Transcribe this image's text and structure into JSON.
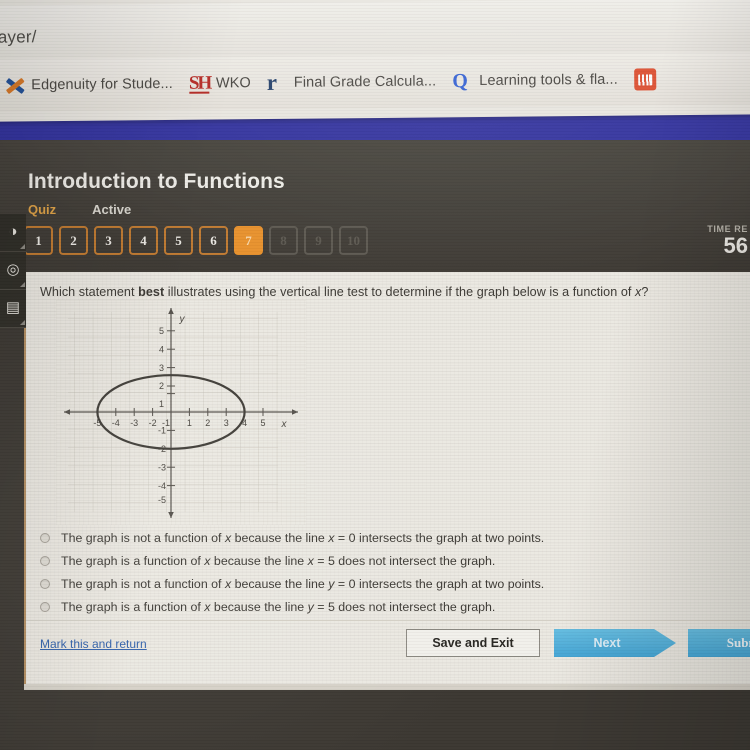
{
  "browser": {
    "url_fragment": "ayer/",
    "bookmarks": [
      {
        "label": "Edgenuity for Stude...",
        "icon": "edgenuity-x-icon"
      },
      {
        "label": "WKO",
        "icon": "sh-icon"
      },
      {
        "label": "Final Grade Calcula...",
        "icon": "rogue-r-icon"
      },
      {
        "label": "Learning tools & fla...",
        "icon": "quizlet-q-icon"
      },
      {
        "label": "",
        "icon": "soundcloud-icon"
      }
    ]
  },
  "header": {
    "title": "Introduction to Functions",
    "type_label": "Quiz",
    "state_label": "Active",
    "timer_label": "TIME RE",
    "timer_value": "56",
    "question_tabs": [
      {
        "number": "1",
        "state": "done"
      },
      {
        "number": "2",
        "state": "done"
      },
      {
        "number": "3",
        "state": "done"
      },
      {
        "number": "4",
        "state": "done"
      },
      {
        "number": "5",
        "state": "done"
      },
      {
        "number": "6",
        "state": "done"
      },
      {
        "number": "7",
        "state": "active"
      },
      {
        "number": "8",
        "state": "locked"
      },
      {
        "number": "9",
        "state": "locked"
      },
      {
        "number": "10",
        "state": "locked"
      }
    ]
  },
  "rail": {
    "items": [
      {
        "glyph": "◑",
        "name": "rail-icon-1"
      },
      {
        "glyph": "◎",
        "name": "rail-icon-2"
      },
      {
        "glyph": "▤",
        "name": "rail-icon-3"
      }
    ]
  },
  "question": {
    "prefix": "Which statement ",
    "emphasis": "best",
    "middle": " illustrates using the vertical line test to determine if the graph below is a function of ",
    "variable": "x",
    "suffix": "?"
  },
  "chart_data": {
    "type": "scatter",
    "title": "",
    "xlabel": "x",
    "ylabel": "y",
    "xlim": [
      -6,
      6
    ],
    "ylim": [
      -6,
      6
    ],
    "grid": true,
    "x_ticks": [
      -5,
      -4,
      -3,
      -2,
      -1,
      1,
      2,
      3,
      4,
      5
    ],
    "y_ticks": [
      5,
      4,
      3,
      2,
      1,
      -1,
      -2,
      -3,
      -4,
      -5
    ],
    "x_tick_labels": [
      "-5",
      "-4",
      "-3",
      "-2",
      "-1",
      "1",
      "2",
      "3",
      "4",
      "5"
    ],
    "y_tick_labels": [
      "5",
      "4",
      "3",
      "2",
      "1",
      "-1",
      "-2",
      "-3",
      "-4",
      "-5"
    ],
    "curves": [
      {
        "name": "ellipse",
        "shape": "ellipse",
        "center": [
          0,
          0
        ],
        "semi_axis_x": 4,
        "semi_axis_y": 2,
        "stroke": "#3f3c36",
        "fill": "none"
      }
    ]
  },
  "options": [
    {
      "id": "option-a",
      "pre": "The graph is not a function of ",
      "var1": "x",
      "mid": " because the line ",
      "var2": "x",
      "eq": " = 0 intersects the graph at two points.",
      "selected": false
    },
    {
      "id": "option-b",
      "pre": "The graph is a function of ",
      "var1": "x",
      "mid": " because the line ",
      "var2": "x",
      "eq": " = 5 does not intersect the graph.",
      "selected": false
    },
    {
      "id": "option-c",
      "pre": "The graph is not a function of ",
      "var1": "x",
      "mid": " because the line ",
      "var2": "y",
      "eq": " = 0 intersects the graph at two points.",
      "selected": false
    },
    {
      "id": "option-d",
      "pre": "The graph is a function of ",
      "var1": "x",
      "mid": " because the line ",
      "var2": "y",
      "eq": " = 5 does not intersect the graph.",
      "selected": false
    }
  ],
  "footer": {
    "mark_link": "Mark this and return",
    "save_label": "Save and Exit",
    "next_label": "Next",
    "submit_label": "Submit"
  },
  "colors": {
    "accent_orange": "#f29120",
    "tab_outline": "#c87a28",
    "button_blue": "#3ca8dd",
    "link_blue": "#2c62b4",
    "header_dark": "#3c3831",
    "band_blue": "#2f2fa8",
    "panel_bg": "#efece4"
  }
}
